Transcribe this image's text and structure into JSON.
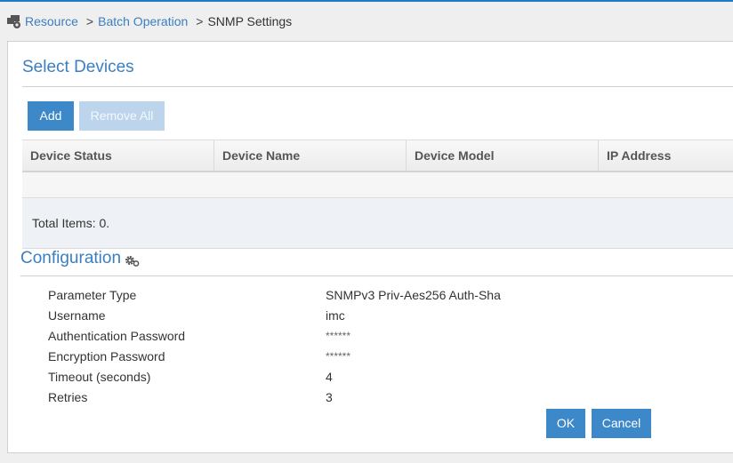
{
  "breadcrumb": {
    "icon": "resource-gear-icon",
    "items": [
      {
        "label": "Resource",
        "link": true
      },
      {
        "label": "Batch Operation",
        "link": true
      },
      {
        "label": "SNMP Settings",
        "link": false
      }
    ],
    "separator": ">"
  },
  "select_devices": {
    "title": "Select Devices",
    "add_label": "Add",
    "remove_all_label": "Remove All",
    "columns": [
      "Device Status",
      "Device Name",
      "Device Model",
      "IP Address"
    ],
    "rows": [],
    "total_text": "Total Items: 0."
  },
  "configuration": {
    "title": "Configuration",
    "icon": "gears-icon",
    "rows": [
      {
        "label": "Parameter Type",
        "value": "SNMPv3 Priv-Aes256 Auth-Sha"
      },
      {
        "label": "Username",
        "value": "imc"
      },
      {
        "label": "Authentication Password",
        "value": "******"
      },
      {
        "label": "Encryption Password",
        "value": "******"
      },
      {
        "label": "Timeout (seconds)",
        "value": "4"
      },
      {
        "label": "Retries",
        "value": "3"
      }
    ]
  },
  "actions": {
    "ok_label": "OK",
    "cancel_label": "Cancel"
  },
  "colors": {
    "accent": "#3d88c9",
    "link": "#3a7fc1",
    "topbar": "#1f7ac7",
    "disabled_button": "#bcd5ec"
  }
}
